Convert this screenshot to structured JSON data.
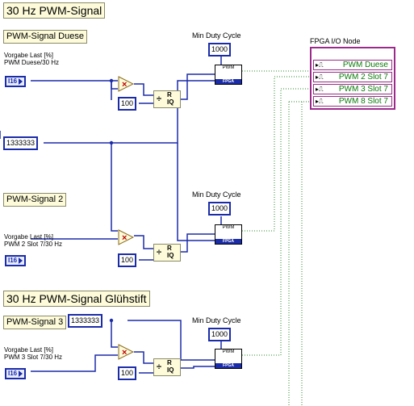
{
  "titles": {
    "main": "30 Hz PWM-Signal",
    "gluhstift": "30 Hz PWM-Signal Glühstift"
  },
  "sections": {
    "duese": "PWM-Signal Duese",
    "s2": "PWM-Signal 2",
    "s3": "PWM-Signal 3"
  },
  "inputs": {
    "duese": {
      "line1": "Vorgabe Last [%]",
      "line2": "PWM Duese/30 Hz",
      "type": "I16"
    },
    "s2": {
      "line1": "Vorgabe Last [%]",
      "line2": "PWM 2 Slot 7/30 Hz",
      "type": "I16"
    },
    "s3": {
      "line1": "Vorgabe Last [%]",
      "line2": "PWM 3 Slot 7/30 Hz",
      "type": "I16"
    }
  },
  "constants": {
    "hundred_a": "100",
    "hundred_b": "100",
    "hundred_c": "100",
    "period_main": "1333333",
    "period_3": "1333333"
  },
  "min_duty": [
    {
      "label": "Min Duty Cycle",
      "value": "1000"
    },
    {
      "label": "Min Duty Cycle",
      "value": "1000"
    },
    {
      "label": "Min Duty Cycle",
      "value": "1000"
    }
  ],
  "pwm_block": {
    "title": "PWM",
    "footer": "FPGA"
  },
  "divide": {
    "symbol": "÷",
    "r": "R",
    "iq": "IQ"
  },
  "multiply_symbol": "×",
  "fpga_node": {
    "label": "FPGA I/O Node",
    "rows": [
      "PWM Duese",
      "PWM 2 Slot 7",
      "PWM 3 Slot 7",
      "PWM 8 Slot 7"
    ]
  },
  "colors": {
    "wire": "#1b2ca8",
    "dotted": "#2a8a2a",
    "fpga": "#9b2b8b",
    "label_bg": "#fdfbd9"
  }
}
